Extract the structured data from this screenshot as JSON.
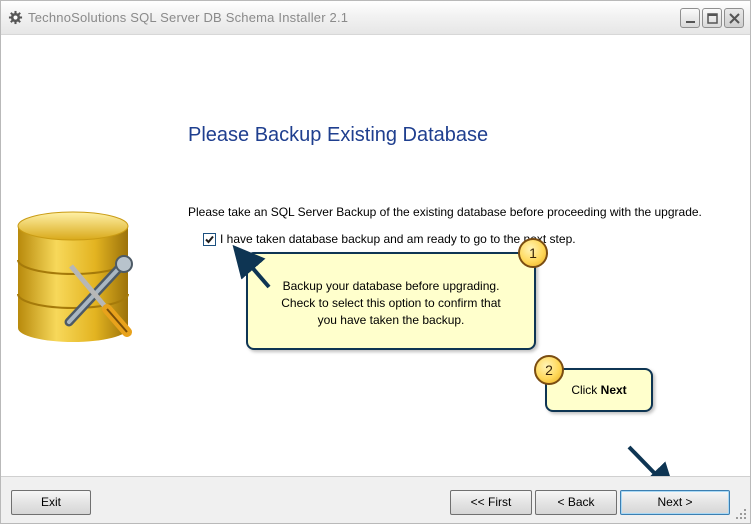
{
  "window": {
    "title": "TechnoSolutions SQL Server DB Schema Installer 2.1",
    "icon": "gear-icon",
    "controls": [
      "minimize-icon",
      "maximize-icon",
      "close-icon"
    ]
  },
  "page": {
    "title": "Please Backup Existing Database",
    "instruction": "Please take an SQL Server Backup of the existing database before proceeding with the upgrade.",
    "checkbox_label": "I have taken database backup and am ready to go to the next step.",
    "checkbox_checked": true,
    "illustration": "database-tools-icon"
  },
  "callouts": [
    {
      "number": "1",
      "lines": [
        "Backup your database before upgrading.",
        "Check to select this option to confirm that",
        "you have taken the backup."
      ]
    },
    {
      "number": "2",
      "prefix": "Click ",
      "emphasis": "Next"
    }
  ],
  "footer": {
    "exit_label": "Exit",
    "first_label": "<< First",
    "back_label": "< Back",
    "next_label": "Next >"
  },
  "colors": {
    "title_blue": "#1f3f8f",
    "callout_fill": "#ffffcc",
    "callout_border": "#0e3553",
    "badge_gold": "#ffd85a"
  }
}
